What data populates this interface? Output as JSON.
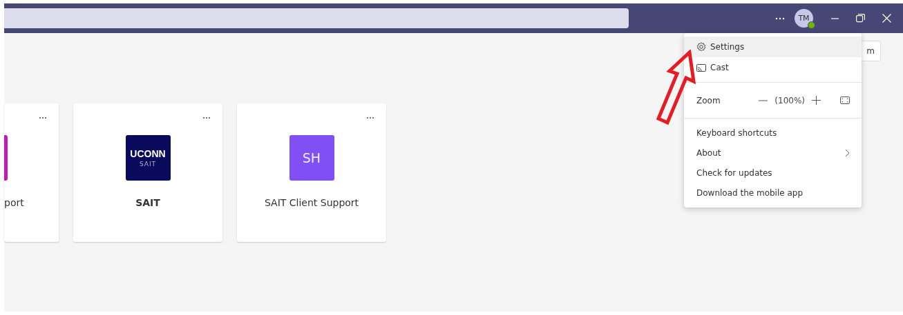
{
  "title_bar": {
    "avatar": {
      "initials": "TM",
      "available": true
    }
  },
  "behind_menu_button": {
    "label": "m"
  },
  "teams": [
    {
      "name": "port",
      "unread": false,
      "logo": {
        "kind": "block",
        "color": "#c219b7"
      }
    },
    {
      "name": "SAIT",
      "unread": true,
      "logo": {
        "kind": "wordmark",
        "color": "#0a0a5c",
        "title": "UCONN",
        "subtitle": "SAIT"
      }
    },
    {
      "name": "SAIT Client Support",
      "unread": false,
      "logo": {
        "kind": "initials",
        "color": "#8150f5",
        "text": "SH"
      }
    }
  ],
  "menu": {
    "groups": [
      [
        {
          "kind": "gear",
          "label": "Settings",
          "selected": true
        },
        {
          "kind": "cast",
          "label": "Cast",
          "selected": false
        }
      ],
      [
        {
          "kind": "zoom",
          "label": "Zoom",
          "value": "(100%)",
          "selected": false
        }
      ],
      [
        {
          "kind": "plain",
          "label": "Keyboard shortcuts",
          "selected": false
        },
        {
          "kind": "submenu",
          "label": "About",
          "selected": false
        },
        {
          "kind": "plain",
          "label": "Check for updates",
          "selected": false
        },
        {
          "kind": "plain",
          "label": "Download the mobile app",
          "selected": false
        }
      ]
    ]
  }
}
